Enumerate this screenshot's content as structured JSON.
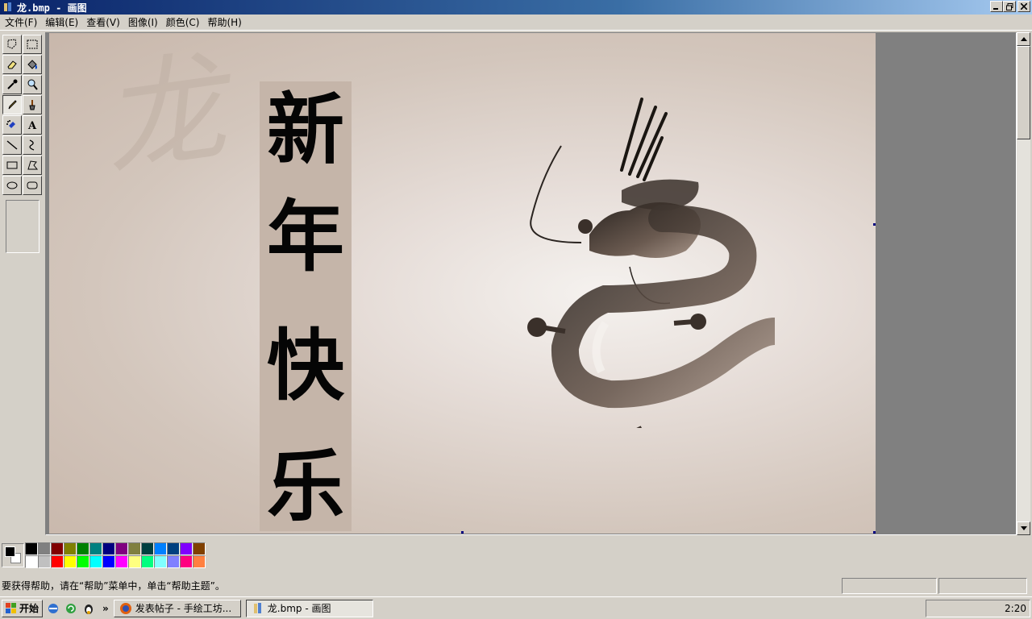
{
  "window": {
    "title": "龙.bmp - 画图"
  },
  "menu": [
    {
      "label": "文件(F)"
    },
    {
      "label": "编辑(E)"
    },
    {
      "label": "查看(V)"
    },
    {
      "label": "图像(I)"
    },
    {
      "label": "颜色(C)"
    },
    {
      "label": "帮助(H)"
    }
  ],
  "tools": [
    {
      "name": "free-select",
      "icon": "free-select-icon"
    },
    {
      "name": "rect-select",
      "icon": "rect-select-icon"
    },
    {
      "name": "eraser",
      "icon": "eraser-icon"
    },
    {
      "name": "fill",
      "icon": "fill-bucket-icon"
    },
    {
      "name": "color-picker",
      "icon": "eyedropper-icon"
    },
    {
      "name": "magnifier",
      "icon": "magnifier-icon"
    },
    {
      "name": "pencil",
      "icon": "pencil-icon",
      "active": true
    },
    {
      "name": "brush",
      "icon": "brush-icon"
    },
    {
      "name": "airbrush",
      "icon": "airbrush-icon"
    },
    {
      "name": "text",
      "icon": "text-icon"
    },
    {
      "name": "line",
      "icon": "line-icon"
    },
    {
      "name": "curve",
      "icon": "curve-icon"
    },
    {
      "name": "rectangle",
      "icon": "rectangle-icon"
    },
    {
      "name": "polygon",
      "icon": "polygon-icon"
    },
    {
      "name": "ellipse",
      "icon": "ellipse-icon"
    },
    {
      "name": "rounded-rect",
      "icon": "rounded-rect-icon"
    }
  ],
  "canvas": {
    "watermark": "龙",
    "banner_chars": [
      "新",
      "年",
      "快",
      "乐"
    ]
  },
  "palette": {
    "foreground": "#000000",
    "background": "#ffffff",
    "colors": [
      "#000000",
      "#808080",
      "#800000",
      "#808000",
      "#008000",
      "#008080",
      "#000080",
      "#800080",
      "#808040",
      "#004040",
      "#0080ff",
      "#004080",
      "#8000ff",
      "#804000",
      "#ffffff",
      "#c0c0c0",
      "#ff0000",
      "#ffff00",
      "#00ff00",
      "#00ffff",
      "#0000ff",
      "#ff00ff",
      "#ffff80",
      "#00ff80",
      "#80ffff",
      "#8080ff",
      "#ff0080",
      "#ff8040"
    ]
  },
  "status": {
    "text": "要获得帮助，请在“帮助”菜单中，单击“帮助主题”。"
  },
  "taskbar": {
    "start_label": "开始",
    "more": "»",
    "tasks": [
      {
        "label": "发表帖子 - 手绘工坊...",
        "active": false
      },
      {
        "label": "龙.bmp - 画图",
        "active": true
      }
    ],
    "clock": "2:20"
  }
}
